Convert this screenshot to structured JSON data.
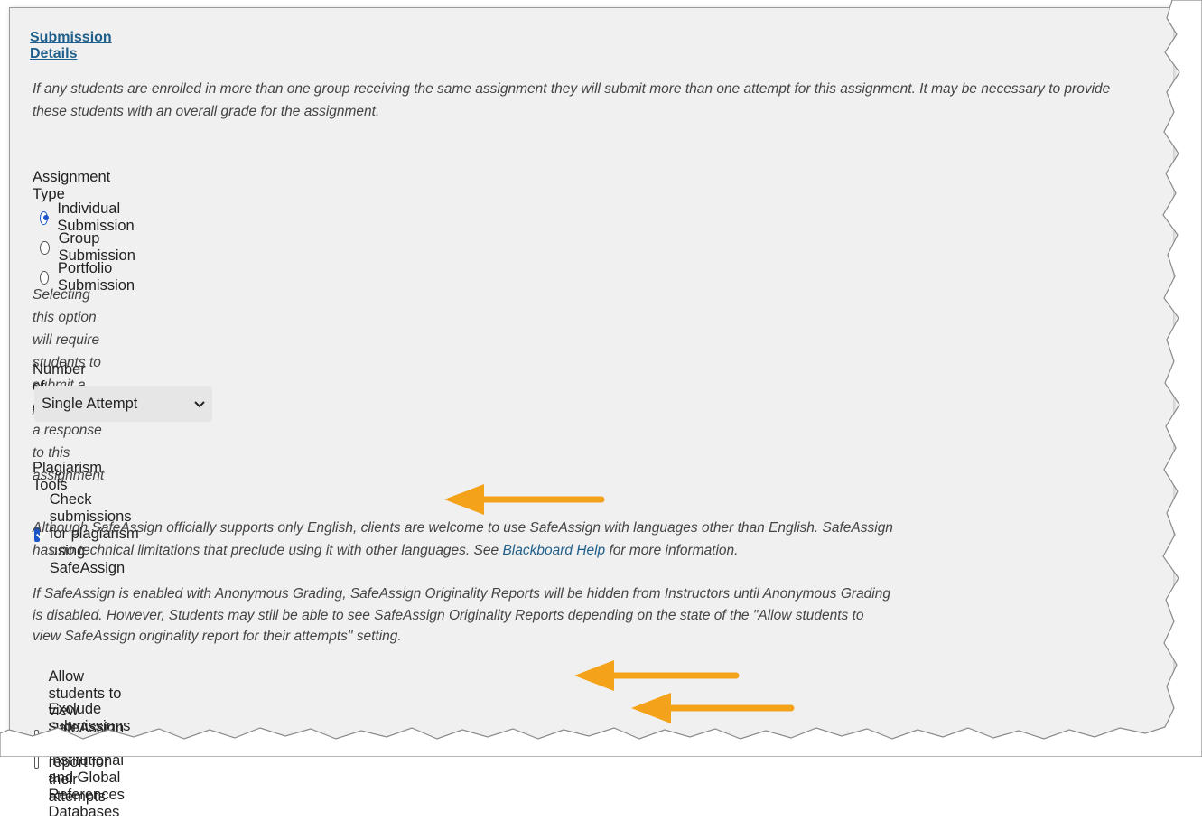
{
  "submission_details": {
    "title": "Submission Details",
    "group_note": "If any students are enrolled in more than one group receiving the same assignment they will submit more than one attempt for this assignment. It may be necessary to provide these students with an overall grade for the assignment."
  },
  "assignment_type": {
    "label": "Assignment Type",
    "options": [
      {
        "label": "Individual Submission",
        "checked": true
      },
      {
        "label": "Group Submission",
        "checked": false
      },
      {
        "label": "Portfolio Submission",
        "checked": false
      }
    ],
    "portfolio_note": "Selecting this option will require students to submit a portfolio as a response to this assignment"
  },
  "attempts": {
    "label": "Number of Attempts",
    "selected": "Single Attempt"
  },
  "plagiarism": {
    "label": "Plagiarism Tools",
    "safeassign_check": {
      "label": "Check submissions for plagiarism using SafeAssign",
      "checked": true
    },
    "note_part1": "Although SafeAssign officially supports only English, clients are welcome to use SafeAssign with languages other than English. SafeAssign has no technical limitations that preclude using it with other languages. See",
    "help_link": "Blackboard Help",
    "note_part2": "for more information.",
    "anon_note": "If SafeAssign is enabled with Anonymous Grading, SafeAssign Originality Reports will be hidden from Instructors until Anonymous Grading is disabled. However, Students may still be able to see SafeAssign Originality Reports depending on the state of the \"Allow students to view SafeAssign originality report for their attempts\" setting.",
    "allow_students": {
      "label": "Allow students to view SafeAssign originality report for their attempts",
      "checked": false
    },
    "exclude_submissions": {
      "label": "Exclude submissions from the Institutional and Global References Databases",
      "checked": false
    }
  },
  "colors": {
    "accent": "#1a56c8",
    "link": "#1f5f8b",
    "arrow": "#f5a21b",
    "panel": "#f0f0f0"
  }
}
